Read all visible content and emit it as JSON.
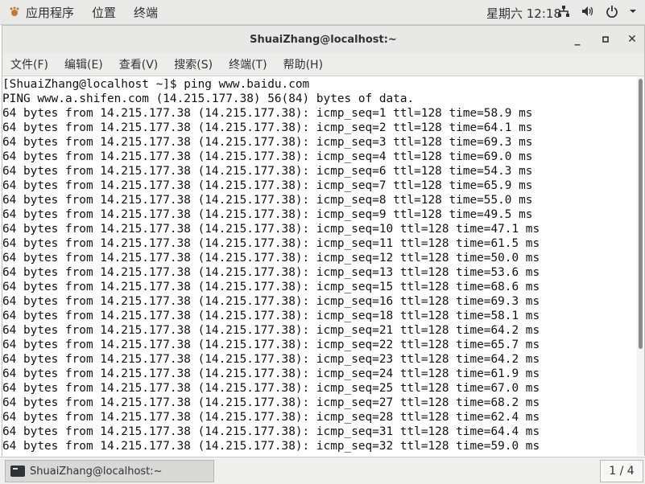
{
  "topbar": {
    "apps_menu": "应用程序",
    "places_menu": "位置",
    "terminal_menu": "终端",
    "clock": "星期六 12:18",
    "icons": [
      "network-icon",
      "volume-icon",
      "power-icon",
      "chevron-down-icon"
    ]
  },
  "window": {
    "title": "ShuaiZhang@localhost:~",
    "minimize": "_",
    "maximize": "▫",
    "close": "✕"
  },
  "menubar": {
    "items": [
      "文件(F)",
      "编辑(E)",
      "查看(V)",
      "搜索(S)",
      "终端(T)",
      "帮助(H)"
    ]
  },
  "terminal": {
    "prompt_line": "[ShuaiZhang@localhost ~]$ ping www.baidu.com",
    "ping_header": "PING www.a.shifen.com (14.215.177.38) 56(84) bytes of data.",
    "replies": [
      {
        "seq": "1",
        "ttl": "128",
        "time": "58.9"
      },
      {
        "seq": "2",
        "ttl": "128",
        "time": "64.1"
      },
      {
        "seq": "3",
        "ttl": "128",
        "time": "69.3"
      },
      {
        "seq": "4",
        "ttl": "128",
        "time": "69.0"
      },
      {
        "seq": "6",
        "ttl": "128",
        "time": "54.3"
      },
      {
        "seq": "7",
        "ttl": "128",
        "time": "65.9"
      },
      {
        "seq": "8",
        "ttl": "128",
        "time": "55.0"
      },
      {
        "seq": "9",
        "ttl": "128",
        "time": "49.5"
      },
      {
        "seq": "10",
        "ttl": "128",
        "time": "47.1"
      },
      {
        "seq": "11",
        "ttl": "128",
        "time": "61.5"
      },
      {
        "seq": "12",
        "ttl": "128",
        "time": "50.0"
      },
      {
        "seq": "13",
        "ttl": "128",
        "time": "53.6"
      },
      {
        "seq": "15",
        "ttl": "128",
        "time": "68.6"
      },
      {
        "seq": "16",
        "ttl": "128",
        "time": "69.3"
      },
      {
        "seq": "18",
        "ttl": "128",
        "time": "58.1"
      },
      {
        "seq": "21",
        "ttl": "128",
        "time": "64.2"
      },
      {
        "seq": "22",
        "ttl": "128",
        "time": "65.7"
      },
      {
        "seq": "23",
        "ttl": "128",
        "time": "64.2"
      },
      {
        "seq": "24",
        "ttl": "128",
        "time": "61.9"
      },
      {
        "seq": "25",
        "ttl": "128",
        "time": "67.0"
      },
      {
        "seq": "27",
        "ttl": "128",
        "time": "68.2"
      },
      {
        "seq": "28",
        "ttl": "128",
        "time": "62.4"
      },
      {
        "seq": "31",
        "ttl": "128",
        "time": "64.4"
      },
      {
        "seq": "32",
        "ttl": "128",
        "time": "59.0"
      }
    ],
    "reply_prefix": "64 bytes from 14.215.177.38 (14.215.177.38): icmp_seq=",
    "ttl_label": "ttl=",
    "time_label": "time=",
    "unit": "ms"
  },
  "taskbar": {
    "task_label": "ShuaiZhang@localhost:~",
    "workspace_pager": "1 / 4"
  }
}
